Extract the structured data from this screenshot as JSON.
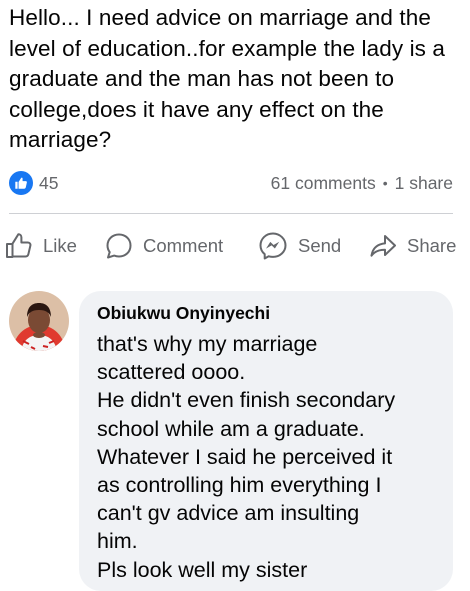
{
  "post": {
    "text": "Hello... I need advice on marriage and the level of education..for example the lady is a graduate and the man has not been to college,does it have any effect on the marriage?"
  },
  "stats": {
    "reaction_icon": "like-icon",
    "reaction_count": "45",
    "comments": "61 comments",
    "separator": "•",
    "shares": "1 share"
  },
  "actions": {
    "like": "Like",
    "comment": "Comment",
    "send": "Send",
    "share": "Share"
  },
  "comment": {
    "author": "Obiukwu Onyinyechi",
    "lines": [
      "that's why my marriage",
      "scattered oooo.",
      "He didn't even finish secondary",
      "school while am a graduate.",
      "Whatever I said he perceived it",
      "as controlling him everything I",
      "can't gv advice am insulting",
      "him.",
      "Pls look well my sister"
    ]
  },
  "colors": {
    "facebook_blue": "#1877f2",
    "secondary_text": "#65676b",
    "bubble_bg": "#f0f2f5",
    "divider": "#ced0d4"
  }
}
